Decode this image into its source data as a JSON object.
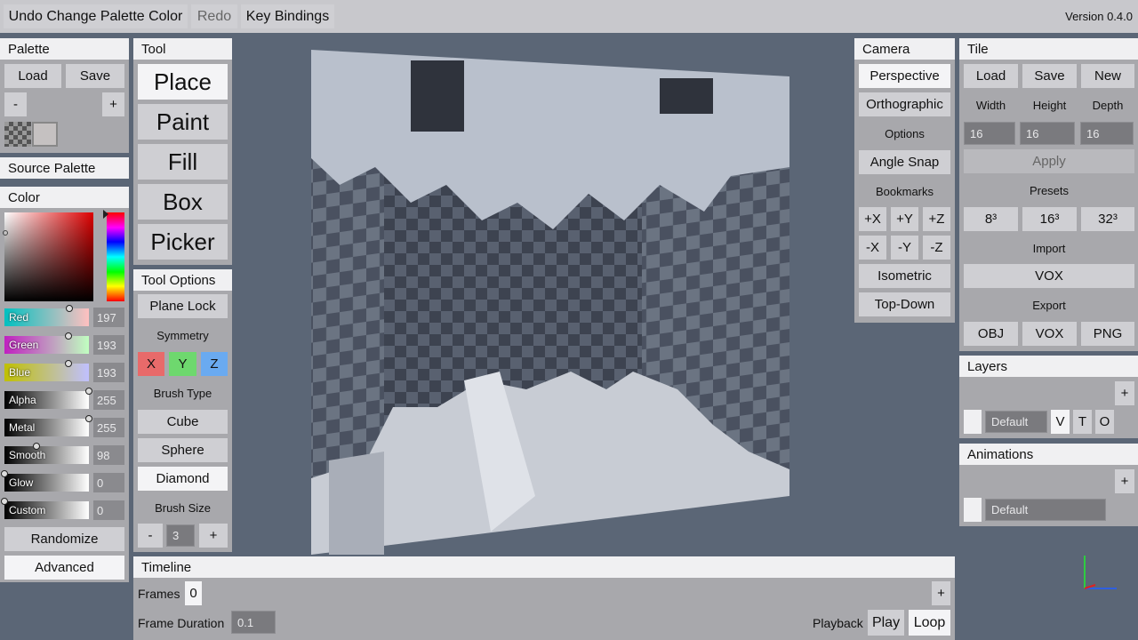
{
  "topbar": {
    "undo": "Undo Change Palette Color",
    "redo": "Redo",
    "keybindings": "Key Bindings",
    "version": "Version 0.4.0"
  },
  "palette": {
    "title": "Palette",
    "load": "Load",
    "save": "Save",
    "minus": "-",
    "plus": "+"
  },
  "source_palette": {
    "title": "Source Palette"
  },
  "color": {
    "title": "Color",
    "selected_hex": "#c5c1c1",
    "sliders": [
      {
        "label": "Red",
        "value": "197",
        "fraction": 0.77
      },
      {
        "label": "Green",
        "value": "193",
        "fraction": 0.76
      },
      {
        "label": "Blue",
        "value": "193",
        "fraction": 0.76
      },
      {
        "label": "Alpha",
        "value": "255",
        "fraction": 1.0
      },
      {
        "label": "Metal",
        "value": "255",
        "fraction": 1.0
      },
      {
        "label": "Smooth",
        "value": "98",
        "fraction": 0.38
      },
      {
        "label": "Glow",
        "value": "0",
        "fraction": 0.0
      },
      {
        "label": "Custom",
        "value": "0",
        "fraction": 0.0
      }
    ],
    "randomize": "Randomize",
    "advanced": "Advanced"
  },
  "tool": {
    "title": "Tool",
    "place": "Place",
    "paint": "Paint",
    "fill": "Fill",
    "box": "Box",
    "picker": "Picker"
  },
  "tool_options": {
    "title": "Tool Options",
    "plane_lock": "Plane Lock",
    "symmetry": "Symmetry",
    "x": "X",
    "y": "Y",
    "z": "Z",
    "brush_type": "Brush Type",
    "cube": "Cube",
    "sphere": "Sphere",
    "diamond": "Diamond",
    "brush_size": "Brush Size",
    "minus": "-",
    "size_value": "3",
    "plus": "+"
  },
  "camera": {
    "title": "Camera",
    "perspective": "Perspective",
    "orthographic": "Orthographic",
    "options": "Options",
    "angle_snap": "Angle Snap",
    "bookmarks": "Bookmarks",
    "px": "+X",
    "py": "+Y",
    "pz": "+Z",
    "mx": "-X",
    "my": "-Y",
    "mz": "-Z",
    "isometric": "Isometric",
    "topdown": "Top-Down"
  },
  "tile": {
    "title": "Tile",
    "load": "Load",
    "save": "Save",
    "new": "New",
    "width": "Width",
    "height": "Height",
    "depth": "Depth",
    "width_val": "16",
    "height_val": "16",
    "depth_val": "16",
    "apply": "Apply",
    "presets": "Presets",
    "p8": "8³",
    "p16": "16³",
    "p32": "32³",
    "import": "Import",
    "vox_import": "VOX",
    "export": "Export",
    "obj": "OBJ",
    "vox_export": "VOX",
    "png": "PNG"
  },
  "layers": {
    "title": "Layers",
    "plus": "+",
    "name": "Default",
    "v": "V",
    "t": "T",
    "o": "O"
  },
  "animations": {
    "title": "Animations",
    "plus": "+",
    "name": "Default"
  },
  "timeline": {
    "title": "Timeline",
    "frames": "Frames",
    "frames_val": "0",
    "plus": "+",
    "frame_duration": "Frame Duration",
    "duration_val": "0.1",
    "playback": "Playback",
    "play": "Play",
    "loop": "Loop"
  },
  "colors": {
    "bg": "#5b6676",
    "panel": "#a8a8ac",
    "header": "#f0f0f2",
    "button": "#cfcfd3"
  }
}
